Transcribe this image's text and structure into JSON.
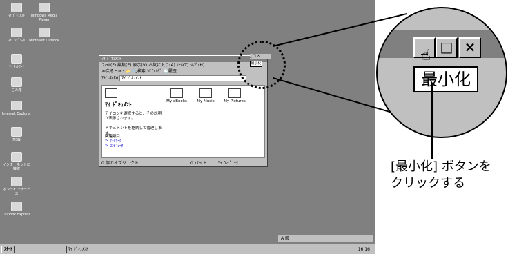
{
  "desktop_icons": [
    {
      "label": "ﾏｲ ﾄﾞｷｭﾒﾝﾄ",
      "icon": "folder-icon"
    },
    {
      "label": "Windows Media Player",
      "icon": "media-player-icon"
    },
    {
      "label": "ﾏｲ ｺﾝﾋﾟｭｰﾀ",
      "icon": "computer-icon"
    },
    {
      "label": "Microsoft Outlook",
      "icon": "outlook-icon"
    },
    {
      "label": "ﾏｲ ﾈｯﾄﾜｰｸ",
      "icon": "network-icon"
    },
    {
      "label": "ごみ箱",
      "icon": "recycle-bin-icon"
    },
    {
      "label": "Internet Explorer",
      "icon": "ie-icon"
    },
    {
      "label": "MSN",
      "icon": "msn-icon"
    },
    {
      "label": "インターネットに接続",
      "icon": "connect-icon"
    },
    {
      "label": "オンラインサービス",
      "icon": "folder-icon"
    },
    {
      "label": "Outlook Express",
      "icon": "outlook-express-icon"
    }
  ],
  "window": {
    "title": "ﾏｲ ﾄﾞｷｭﾒﾝﾄ",
    "menu": "ﾌｧｲﾙ(F)  編集(E)  表示(V)  お気に入り(A)  ﾂｰﾙ(T)  ﾍﾙﾌﾟ(H)",
    "toolbar": "⇐戻る・⇒・📁  🔍検索  ℃ﾌｫﾙﾀﾞ  🕑履歴",
    "address_label": "ｱﾄﾞﾚｽ(D)",
    "address_value": "ﾏｲ ﾄﾞｷｭﾒﾝﾄ",
    "content_heading": "ﾏｲ ﾄﾞｷｭﾒﾝﾄ",
    "content_desc": "アイコンを選択すると、その説明が表示されます。",
    "content_manage": "ドキュメントを格納して管理します。",
    "related_heading": "関連項目",
    "related_links": [
      "ﾏｲ ﾈｯﾄﾜｰｸ",
      "ﾏｲ ｺﾝﾋﾟｭｰﾀ"
    ],
    "folders": [
      "My eBooks",
      "My Music",
      "My Pictures"
    ],
    "status_objects": "0 個のオブジェクト",
    "status_size": "0 バイト",
    "status_location": "ﾏｲ ｺﾝﾋﾟｭｰﾀ"
  },
  "small_tooltip": "最小化",
  "taskbar": {
    "start": "ｽﾀｰﾄ",
    "task": "ﾏｲ ﾄﾞｷｭﾒﾝﾄ",
    "clock": "16:16",
    "ime": "A 般"
  },
  "zoom": {
    "minimize_glyph": "_",
    "maximize_glyph": "□",
    "close_glyph": "×",
    "tooltip": "最小化"
  },
  "caption": {
    "line1": "[最小化] ボタンを",
    "line2": "クリックする"
  }
}
